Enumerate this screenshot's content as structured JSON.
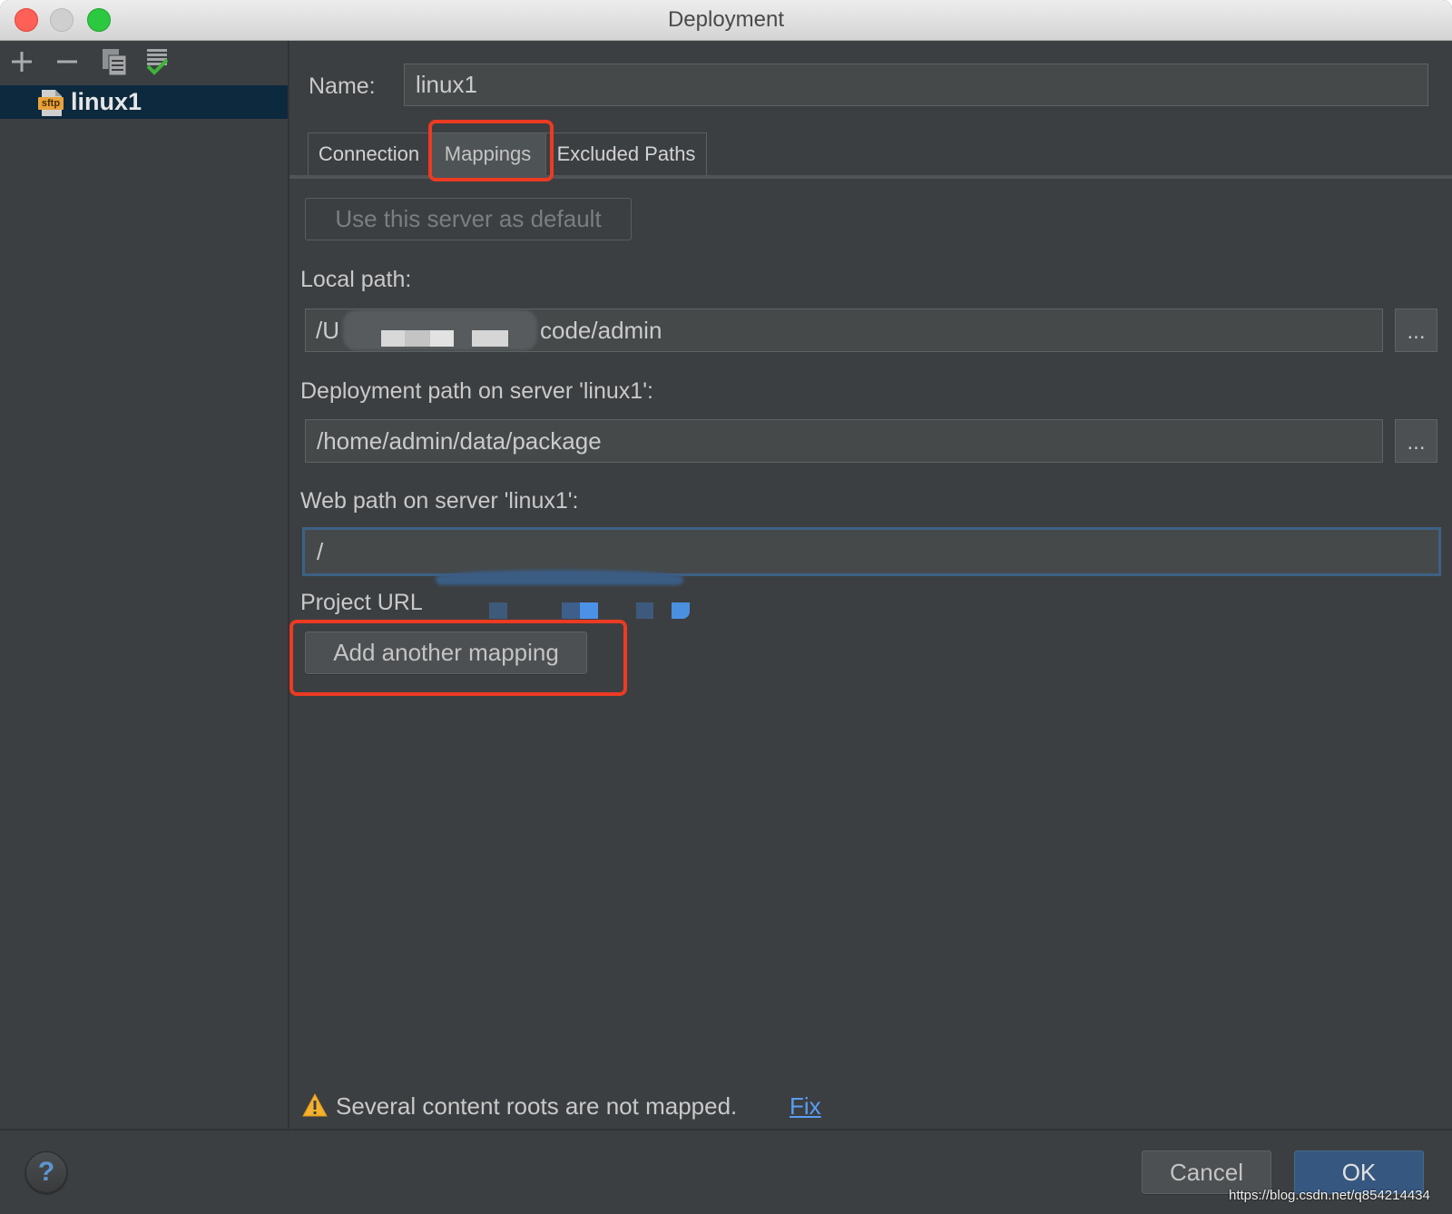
{
  "window": {
    "title": "Deployment"
  },
  "sidebar": {
    "toolbar_icons": [
      "add-icon",
      "remove-icon",
      "copy-icon",
      "test-connection-icon"
    ],
    "servers": [
      {
        "label": "linux1",
        "icon": "sftp-server-icon",
        "icon_label": "sftp",
        "selected": true
      }
    ]
  },
  "form": {
    "name_label": "Name:",
    "name_value": "linux1",
    "tabs": [
      {
        "label": "Connection",
        "selected": false
      },
      {
        "label": "Mappings",
        "selected": true
      },
      {
        "label": "Excluded Paths",
        "selected": false
      }
    ],
    "default_server_button": "Use this server as default",
    "local_path_label": "Local path:",
    "local_path": {
      "prefix": "/U",
      "suffix": "code/admin"
    },
    "deployment_path_label": "Deployment path on server 'linux1':",
    "deployment_path_value": "/home/admin/data/package",
    "web_path_label": "Web path on server 'linux1':",
    "web_path_value": "/",
    "project_url_label": "Project URL",
    "browse_label": "...",
    "add_mapping_button": "Add another mapping",
    "warning_icon": "warning-icon",
    "warning_text": "Several content roots are not mapped.",
    "fix_link": "Fix"
  },
  "footer": {
    "help_label": "?",
    "cancel_label": "Cancel",
    "ok_label": "OK"
  },
  "watermark": "https://blog.csdn.net/q854214434",
  "colors": {
    "background": "#3c3f41",
    "selection": "#0d293e",
    "default_button": "#365880",
    "link": "#589df6",
    "focus_border": "#3d6185",
    "annotation_highlight": "#ec3b22",
    "warning": "#f4b12d"
  }
}
